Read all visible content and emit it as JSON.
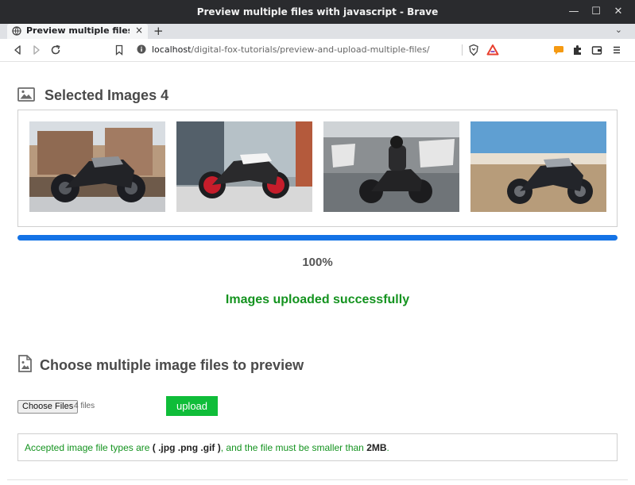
{
  "window": {
    "title": "Preview multiple files with javascript - Brave",
    "minimize": "—",
    "maximize": "☐",
    "close": "✕"
  },
  "tabs": {
    "active_label": "Preview multiple files with javascript",
    "close": "×",
    "new_tab": "+",
    "menu": "⌄"
  },
  "toolbar": {
    "url_host": "localhost",
    "url_path": "/digital-fox-tutorials/preview-and-upload-multiple-files/"
  },
  "gallery": {
    "heading": "Selected Images 4",
    "images": [
      {
        "name": "motorcycle-brick-house",
        "colors": [
          "#b89a7e",
          "#6e5a4a",
          "#1c1d22",
          "#c7c9cc"
        ]
      },
      {
        "name": "red-motorcycle-building",
        "colors": [
          "#9aa3a8",
          "#54606a",
          "#c61d2b",
          "#d8d8d8"
        ]
      },
      {
        "name": "rider-motion-graffiti",
        "colors": [
          "#cfd3d6",
          "#6f7478",
          "#1c1c1e",
          "#8b8f92"
        ]
      },
      {
        "name": "motorcycle-coast-sky",
        "colors": [
          "#5f9fd2",
          "#b79c7a",
          "#1e2024",
          "#e8dfd1"
        ]
      }
    ]
  },
  "progress": {
    "value": 100,
    "label": "100%",
    "color": "#1473e6"
  },
  "status": {
    "message": "Images uploaded successfully",
    "color": "#14931f"
  },
  "upload": {
    "heading": "Choose multiple image files to preview",
    "choose_label": "Choose Files",
    "file_count": "4 files",
    "upload_label": "upload",
    "button_color": "#0fbd39"
  },
  "notice": {
    "prefix": "Accepted image file types are ",
    "types": "( .jpg .png .gif )",
    "middle": ", and the file must be smaller than ",
    "size": "2MB",
    "suffix": "."
  }
}
